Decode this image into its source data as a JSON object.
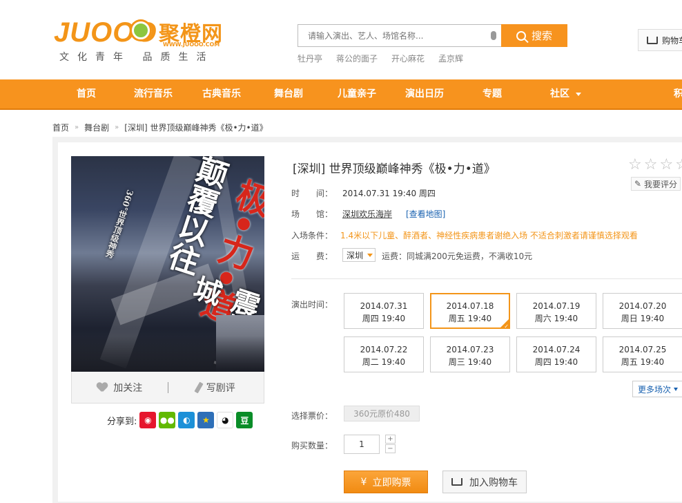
{
  "header": {
    "logo_text": "JUOOO",
    "logo_cn": "聚橙网",
    "logo_url": "WWW.JUOOO.COM",
    "slogan": "文化青年 品质生活",
    "search_placeholder": "请输入演出、艺人、场馆名称...",
    "search_button": "搜索",
    "hot_words": [
      "牡丹亭",
      "蒋公的面子",
      "开心麻花",
      "孟京辉"
    ],
    "cart_label": "购物车"
  },
  "nav": {
    "items": [
      "首页",
      "流行音乐",
      "古典音乐",
      "舞台剧",
      "儿童亲子",
      "演出日历",
      "专题",
      "社区",
      "积"
    ]
  },
  "breadcrumb": [
    "首页",
    "舞台剧",
    "[深圳] 世界顶级巅峰神秀《极•力•道》"
  ],
  "poster": {
    "text_top": "颠覆以往",
    "text_main": "极•力•道",
    "text_sub": "360°世界顶级神秀",
    "text_bottom": "震撼全城",
    "follow_label": "加关注",
    "review_label": "写剧评"
  },
  "share": {
    "label": "分享到:",
    "icons": [
      "weibo-icon",
      "wechat-icon",
      "tencent-weibo-icon",
      "qzone-icon",
      "qq-icon",
      "douban-icon"
    ],
    "douban_glyph": "豆"
  },
  "event": {
    "title": "[深圳] 世界顶级巅峰神秀《极•力•道》",
    "rate_label": "我要评分",
    "time_label": "时　　间：",
    "time_value": "2014.07.31 19:40 周四",
    "venue_label": "场　　馆：",
    "venue_value": "深圳欢乐海岸",
    "map_link": "[查看地图]",
    "entry_label": "入场条件：",
    "entry_value": "1.4米以下儿童、醉酒者、神经性疾病患者谢绝入场 不适合刺激者请谨慎选择观看",
    "shipping_label": "运　　费：",
    "shipping_city": "深圳",
    "shipping_value": "运费：同城满200元免运费，不满收10元",
    "session_label": "演出时间：",
    "sessions": [
      {
        "date": "2014.07.31",
        "day": "周四 19:40"
      },
      {
        "date": "2014.07.18",
        "day": "周五 19:40"
      },
      {
        "date": "2014.07.19",
        "day": "周六 19:40"
      },
      {
        "date": "2014.07.20",
        "day": "周日 19:40"
      },
      {
        "date": "2014.07.22",
        "day": "周二 19:40"
      },
      {
        "date": "2014.07.23",
        "day": "周三 19:40"
      },
      {
        "date": "2014.07.24",
        "day": "周四 19:40"
      },
      {
        "date": "2014.07.25",
        "day": "周五 19:40"
      }
    ],
    "more_sessions": "更多场次",
    "price_label": "选择票价：",
    "price_option": "360元原价480",
    "qty_label": "购买数量：",
    "qty_value": "1",
    "buy_button": "立即购票",
    "cart_button": "加入购物车"
  },
  "colors": {
    "accent": "#f7931e",
    "link": "#1a62b0"
  }
}
